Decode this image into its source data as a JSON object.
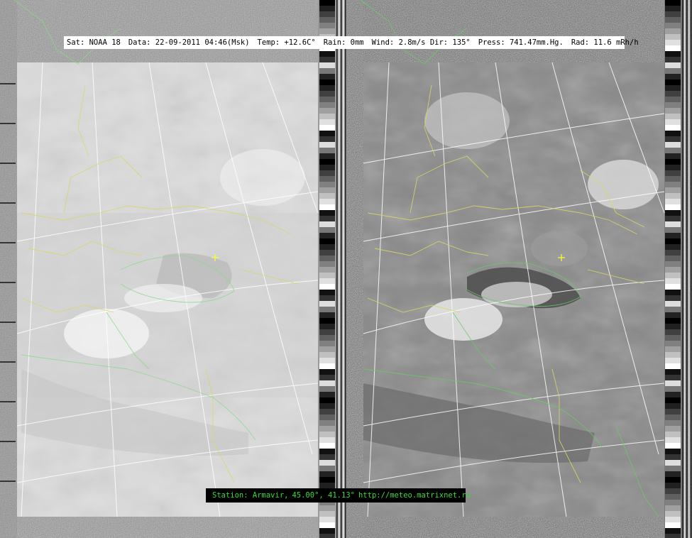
{
  "header": {
    "satellite": "Sat: NOAA 18",
    "date": "Data: 22-09-2011 04:46(Msk)",
    "temperature": "Temp: +12.6C°",
    "rain": "Rain: 0mm",
    "wind": "Wind: 2.8m/s Dir: 135°",
    "pressure": "Press: 741.47mm.Hg.",
    "radiation": "Rad: 11.6 mRh/h"
  },
  "station": {
    "name": "Station: Armavir,",
    "coordinates": "45.00°, 41.13°",
    "url": "http://meteo.matrixnet.ru"
  },
  "colors": {
    "coastline": "#66cc66",
    "borders": "#cccc44",
    "grid": "#ffffff",
    "station_marker": "#ffff33",
    "header_bg": "#ffffff",
    "station_bg": "#000000",
    "station_text": "#33dd33"
  }
}
